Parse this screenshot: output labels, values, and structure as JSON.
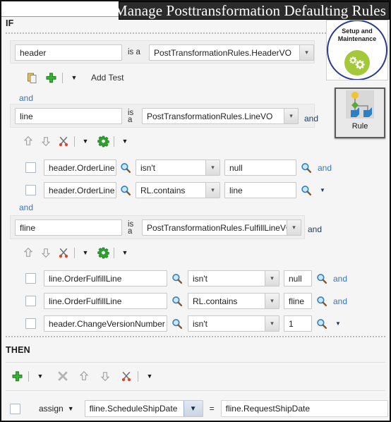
{
  "window": {
    "title": "Manage Posttransformation Defaulting Rules"
  },
  "sections": {
    "if_label": "IF",
    "then_label": "THEN"
  },
  "side_panel": {
    "setup_tile": {
      "line1": "Setup and",
      "line2": "Maintenance",
      "icon": "gears-icon"
    },
    "rule_tile": {
      "label": "Rule",
      "icon": "rule-tree-icon"
    }
  },
  "if_section": {
    "fact_rows": [
      {
        "variable": "header",
        "is_a_label": "is a",
        "type": "PostTransformationRules.HeaderVO",
        "trailing_and": ""
      },
      {
        "variable": "line",
        "is_a_label": "is a",
        "type": "PostTransformationRules.LineVO",
        "trailing_and": "and"
      },
      {
        "variable": "fline",
        "is_a_label": "is a",
        "type": "PostTransformationRules.FulfillLineVO",
        "trailing_and": "and"
      }
    ],
    "toolbar_1": {
      "copy_icon": "copy-icon",
      "add_icon": "plus-icon",
      "dropdown_icon": "caret-down-icon",
      "add_test_label": "Add Test"
    },
    "toolbar_2": {
      "move_up_icon": "arrow-up-icon",
      "move_down_icon": "arrow-down-icon",
      "cut_icon": "scissors-icon",
      "cut_menu_icon": "caret-down-icon",
      "settings_icon": "gear-icon",
      "settings_menu_icon": "caret-down-icon"
    },
    "toolbar_3": {
      "move_up_icon": "arrow-up-icon",
      "move_down_icon": "arrow-down-icon",
      "cut_icon": "scissors-icon",
      "cut_menu_icon": "caret-down-icon",
      "settings_icon": "gear-icon",
      "settings_menu_icon": "caret-down-icon"
    },
    "connector_and_1": "and",
    "connector_and_2": "and",
    "tests_group_1": [
      {
        "checked": false,
        "left": "header.OrderLine",
        "operator": "isn't",
        "right": "null",
        "connector": "and",
        "connector_type": "text"
      },
      {
        "checked": false,
        "left": "header.OrderLine",
        "operator": "RL.contains",
        "right": "line",
        "connector": "",
        "connector_type": "caret"
      }
    ],
    "tests_group_2": [
      {
        "checked": false,
        "left": "line.OrderFulfillLine",
        "operator": "isn't",
        "right": "null",
        "connector": "and",
        "connector_type": "text"
      },
      {
        "checked": false,
        "left": "line.OrderFulfillLine",
        "operator": "RL.contains",
        "right": "fline",
        "connector": "and",
        "connector_type": "text"
      },
      {
        "checked": false,
        "left": "header.ChangeVersionNumber",
        "operator": "isn't",
        "right": "1",
        "connector": "",
        "connector_type": "caret"
      }
    ]
  },
  "then_section": {
    "toolbar": {
      "add_icon": "plus-icon",
      "add_menu_icon": "caret-down-icon",
      "delete_icon": "x-icon",
      "move_up_icon": "arrow-up-icon",
      "move_down_icon": "arrow-down-icon",
      "cut_icon": "scissors-icon",
      "cut_menu_icon": "caret-down-icon"
    },
    "action_row": {
      "checked": false,
      "action": "assign",
      "action_caret": "caret-down-icon",
      "target": "fline.ScheduleShipDate",
      "equals": "=",
      "value": "fline.RequestShipDate"
    }
  },
  "colors": {
    "title_bar_bg": "#2b2b2b",
    "link_blue": "#3b76b5",
    "accent_green": "#2fa02f",
    "setup_ring": "#2a3b8f",
    "setup_ball": "#a3c93a"
  }
}
